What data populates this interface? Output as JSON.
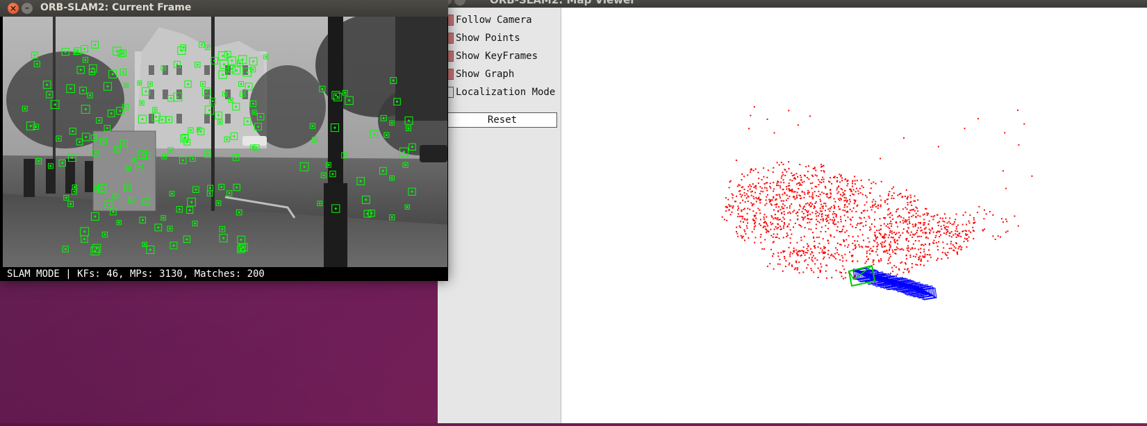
{
  "frame_window": {
    "title": "ORB-SLAM2: Current Frame",
    "close_symbol": "×",
    "minimize_symbol": "–",
    "status_text": "SLAM MODE |  KFs: 46, MPs: 3130, Matches: 200",
    "feature_color": "#00ff00"
  },
  "map_window": {
    "title": "ORB-SLAM2: Map Viewer",
    "controls": [
      {
        "label": "Follow Camera",
        "checked": true
      },
      {
        "label": "Show Points",
        "checked": true
      },
      {
        "label": "Show KeyFrames",
        "checked": true
      },
      {
        "label": "Show Graph",
        "checked": true
      },
      {
        "label": "Localization Mode",
        "checked": false
      }
    ],
    "reset_label": "Reset",
    "map_point_color": "#ff0000",
    "keyframe_color": "#0000ff",
    "current_camera_color": "#00cc00"
  },
  "colors": {
    "desktop_background": "#6e1d57",
    "titlebar": "#3c3b37",
    "panel_background": "#e6e6e6",
    "checkbox_checked": "#c9787b"
  }
}
